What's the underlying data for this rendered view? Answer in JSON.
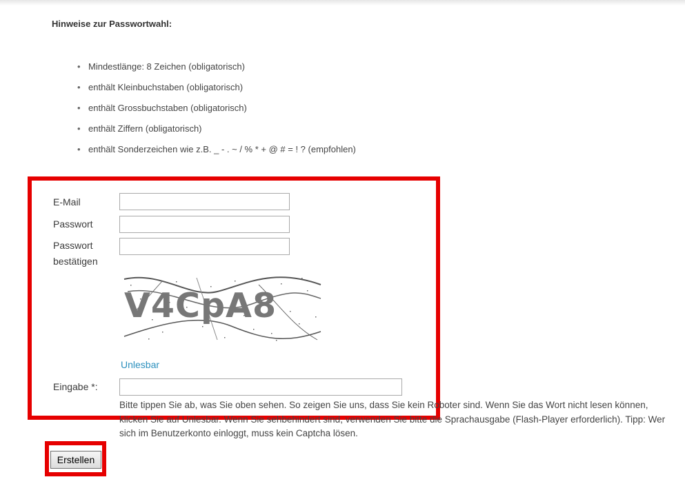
{
  "hints": {
    "heading": "Hinweise zur Passwortwahl:",
    "rules": [
      "Mindestlänge: 8 Zeichen (obligatorisch)",
      "enthält Kleinbuchstaben (obligatorisch)",
      "enthält Grossbuchstaben (obligatorisch)",
      "enthält Ziffern (obligatorisch)",
      "enthält Sonderzeichen wie z.B. _ - . ~ / % * + @ # = ! ? (empfohlen)"
    ]
  },
  "form": {
    "email_label": "E-Mail",
    "email_value": "",
    "password_label": "Passwort",
    "password_value": "",
    "confirm_label_line1": "Passwort",
    "confirm_label_line2": "bestätigen",
    "confirm_value": "",
    "captcha_text": "V4CpA8",
    "unreadable_link": "Unlesbar",
    "input_label": "Eingabe *:",
    "input_value": "",
    "help_text": "Bitte tippen Sie ab, was Sie oben sehen. So zeigen Sie uns, dass Sie kein Roboter sind. Wenn Sie das Wort nicht lesen können, klicken Sie auf Unlesbar. Wenn Sie sehbehindert sind, verwenden Sie bitte die Sprachausgabe (Flash-Player erforderlich). Tipp: Wer sich im Benutzerkonto einloggt, muss kein Captcha lösen.",
    "submit_label": "Erstellen"
  },
  "colors": {
    "highlight": "#e60000",
    "link": "#2a8fbd",
    "text": "#444444"
  }
}
